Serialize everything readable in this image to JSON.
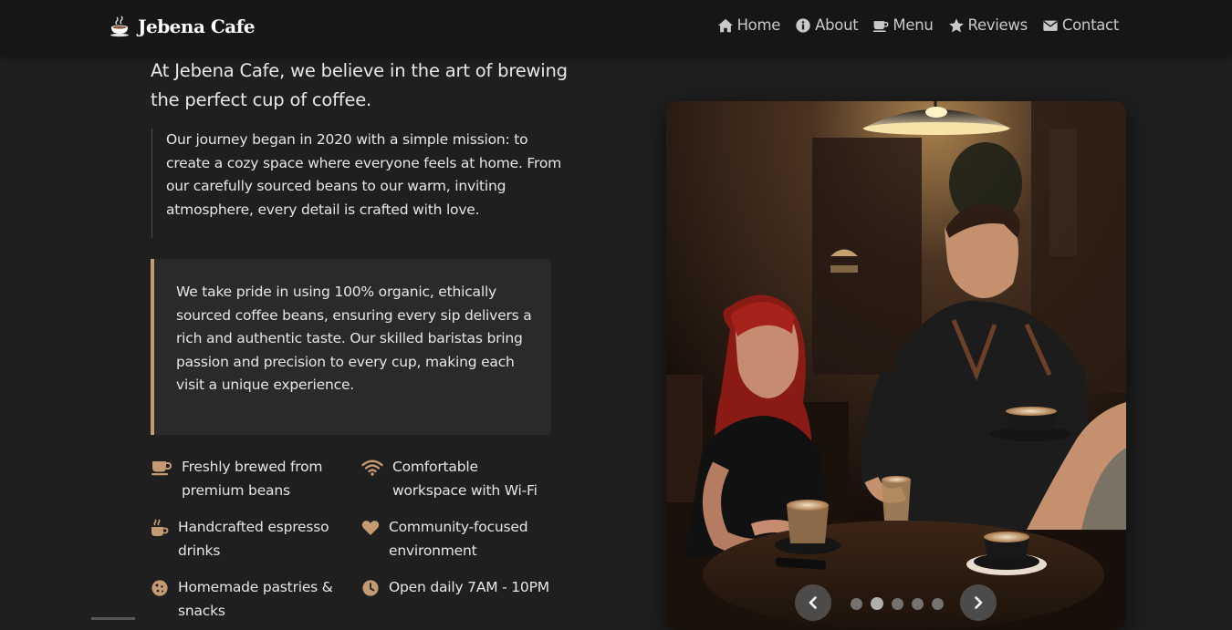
{
  "brand": {
    "name": "Jebena Cafe",
    "icon": "coffee-cup-icon"
  },
  "nav": [
    {
      "label": "Home",
      "icon": "home-icon"
    },
    {
      "label": "About",
      "icon": "info-icon"
    },
    {
      "label": "Menu",
      "icon": "coffee-icon"
    },
    {
      "label": "Reviews",
      "icon": "star-icon"
    },
    {
      "label": "Contact",
      "icon": "envelope-icon"
    }
  ],
  "about": {
    "lead": "At Jebena Cafe, we believe in the art of brewing the perfect cup of coffee.",
    "journey": "Our journey began in 2020 with a simple mission: to create a cozy space where everyone feels at home. From our carefully sourced beans to our warm, inviting atmosphere, every detail is crafted with love.",
    "pride": "We take pride in using 100% organic, ethically sourced coffee beans, ensuring every sip delivers a rich and authentic taste. Our skilled baristas bring passion and precision to every cup, making each visit a unique experience."
  },
  "features": [
    {
      "text": "Freshly brewed from premium beans",
      "icon": "coffee-icon"
    },
    {
      "text": "Comfortable workspace with Wi-Fi",
      "icon": "wifi-icon"
    },
    {
      "text": "Handcrafted espresso drinks",
      "icon": "mug-hot-icon"
    },
    {
      "text": "Community-focused environment",
      "icon": "heart-icon"
    },
    {
      "text": "Homemade pastries & snacks",
      "icon": "cookie-icon"
    },
    {
      "text": "Open daily 7AM - 10PM",
      "icon": "clock-icon"
    }
  ],
  "carousel": {
    "slides": 5,
    "active_index": 1
  },
  "colors": {
    "accent": "#c49a72",
    "background": "#1f1f1f",
    "navbar": "#161616",
    "card": "#2a2a2a"
  }
}
